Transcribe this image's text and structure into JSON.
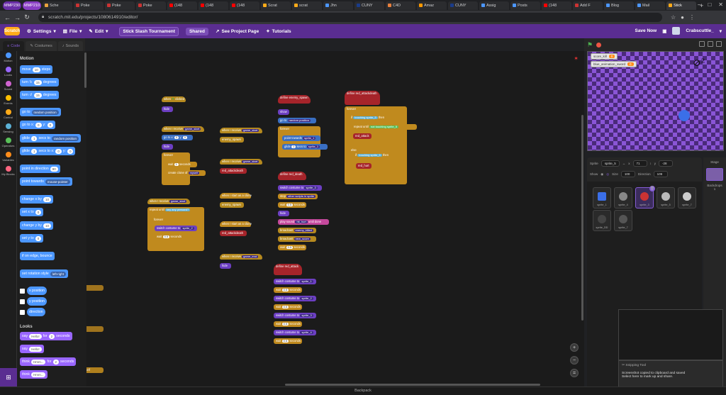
{
  "browser": {
    "tabs": [
      {
        "label": "MMP230",
        "pill": true
      },
      {
        "label": "MMP210",
        "pill": true
      },
      {
        "label": "Sche",
        "color": "#e8a33d"
      },
      {
        "label": "Poke",
        "color": "#cc3333"
      },
      {
        "label": "Poke",
        "color": "#cc3333"
      },
      {
        "label": "Poke",
        "color": "#cc3333"
      },
      {
        "label": "(148",
        "color": "#ff0000"
      },
      {
        "label": "(148",
        "color": "#ff0000"
      },
      {
        "label": "(148",
        "color": "#ff0000"
      },
      {
        "label": "Scrat",
        "color": "#ffab19"
      },
      {
        "label": "scrat",
        "color": "#ffab19"
      },
      {
        "label": "Jhn",
        "color": "#4c97ff"
      },
      {
        "label": "CUNY",
        "color": "#1a3c8a"
      },
      {
        "label": "C4D",
        "color": "#e8803d"
      },
      {
        "label": "Amaz",
        "color": "#ff9900"
      },
      {
        "label": "CUNY",
        "color": "#1a3c8a"
      },
      {
        "label": "Assig",
        "color": "#4c97ff"
      },
      {
        "label": "Posts",
        "color": "#4c97ff"
      },
      {
        "label": "(148",
        "color": "#ff0000"
      },
      {
        "label": "Add F",
        "color": "#cc3333"
      },
      {
        "label": "Blog",
        "color": "#4c97ff"
      },
      {
        "label": "Mail",
        "color": "#4c97ff"
      },
      {
        "label": "Stick",
        "color": "#ffab19",
        "active": true
      }
    ],
    "url": "scratch.mit.edu/projects/1080614910/editor/"
  },
  "menu": {
    "logo": "Scratch",
    "settings": "Settings",
    "file": "File",
    "edit": "Edit",
    "project_title": "Stick Slash Tournament",
    "shared": "Shared",
    "see_project_page": "See Project Page",
    "tutorials": "Tutorials",
    "save_now": "Save Now",
    "username": "Crabscuttle_"
  },
  "editor_tabs": {
    "code": "Code",
    "costumes": "Costumes",
    "sounds": "Sounds"
  },
  "categories": [
    {
      "label": "Motion",
      "color": "#4c97ff"
    },
    {
      "label": "Looks",
      "color": "#9966ff"
    },
    {
      "label": "Sound",
      "color": "#cf63cf"
    },
    {
      "label": "Events",
      "color": "#ffbf00"
    },
    {
      "label": "Control",
      "color": "#ffab19"
    },
    {
      "label": "Sensing",
      "color": "#5cb1d6"
    },
    {
      "label": "Operators",
      "color": "#59c059"
    },
    {
      "label": "Variables",
      "color": "#ff8c1a"
    },
    {
      "label": "My Blocks",
      "color": "#ff6680"
    }
  ],
  "palette": {
    "motion_header": "Motion",
    "looks_header": "Looks",
    "move": "move",
    "move_val": "10",
    "steps": "steps",
    "turn": "turn",
    "turn1_val": "15",
    "degrees": "degrees",
    "turn2_val": "15",
    "goto": "go to",
    "goto_val": "random position",
    "gotoxy": "go to x:",
    "x_val": "0",
    "y_label": "y:",
    "y_val": "0",
    "glide1": "glide",
    "glide_secs": "1",
    "secs_to": "secs to",
    "glide1_val": "random position",
    "glide2_x": "secs to x:",
    "point_dir": "point in direction",
    "dir_val": "90",
    "point_towards": "point towards",
    "towards_val": "mouse-pointer",
    "change_x": "change x by",
    "change_val": "10",
    "set_x": "set x to",
    "set_x_val": "0",
    "change_y": "change y by",
    "set_y": "set y to",
    "bounce": "if on edge, bounce",
    "rotation": "set rotation style",
    "rotation_val": "left-right",
    "xpos": "x position",
    "ypos": "y position",
    "direction": "direction",
    "say_for": "say",
    "hello": "Hello!",
    "for": "for",
    "seconds": "seconds",
    "say_secs": "2",
    "say": "say",
    "think_for": "think",
    "hmm": "Hmm...",
    "think_secs": "2",
    "think": "think"
  },
  "code_blocks": {
    "when_flag": "when",
    "clicked": "clicked",
    "hide": "hide",
    "when_receive": "when I receive",
    "game_start": "game_start",
    "game_end": "game_end",
    "goto_xy": "go to x:",
    "x0": "0",
    "y_lbl": "y:",
    "y0": "0",
    "forever": "forever",
    "wait": "wait",
    "wait1": "1",
    "seconds": "seconds",
    "create_clone": "create clone of",
    "myself": "myself",
    "enemy_spawn": "enemy_spawn",
    "red_attackdeath": "red_attackdeath",
    "repeat_until": "repeat until",
    "key": "key",
    "any": "any",
    "pressed": "pressed?",
    "switch_costume": "switch costume to",
    "sprite_2": "sprite_2",
    "wait_half": "0.5",
    "start_clone": "when I start as a clone",
    "show": "show",
    "random_position": "random position",
    "point_dir": "point in direction",
    "dir_val": "90",
    "glide": "glide",
    "secs_to": "secs to",
    "define_red_death": "define",
    "red_death": "red_death",
    "sprite_3": "sprite_3",
    "stop": "stop",
    "other_scripts": "other scripts in sprite",
    "play_sound": "play sound",
    "hit_hurt": "hit_hurt",
    "until_done": "until done",
    "broadcast": "broadcast",
    "enemy_killed": "enemy_killed",
    "new_score": "new_score",
    "define_red_attack": "define",
    "red_attack": "red_attack",
    "sprite_1": "sprite_1",
    "sprite_4": "sprite_4",
    "define_attackdeath": "define",
    "if": "if",
    "touching": "touching",
    "sprite_5": "sprite_5",
    "then": "then",
    "else": "else",
    "not": "not",
    "red_hurt": "red_hurt",
    "start": "start"
  },
  "stage": {
    "monitors": [
      {
        "label": "score_kill",
        "value": "0"
      },
      {
        "label": "blue_animation_sword",
        "value": "0"
      }
    ]
  },
  "sprite_info": {
    "sprite_label": "Sprite",
    "sprite_name": "sprite_5",
    "x_label": "x",
    "x_val": "71",
    "y_label": "y",
    "y_val": "-28",
    "show_label": "Show",
    "size_label": "Size",
    "size_val": "100",
    "direction_label": "Direction",
    "direction_val": "109"
  },
  "sprites": [
    {
      "name": "sprite_1",
      "color": "#3b6fe8"
    },
    {
      "name": "sprite_4",
      "color": "#888"
    },
    {
      "name": "sprite_3",
      "color": "#c33",
      "selected": true
    },
    {
      "name": "sprite_5",
      "color": "#bbb"
    },
    {
      "name": "sprite_7",
      "color": "#ccc"
    },
    {
      "name": "sprite_DD",
      "color": "#444"
    },
    {
      "name": "sprite_7",
      "color": "#555"
    }
  ],
  "stage_pane": {
    "title": "Stage",
    "backdrops_label": "Backdrops",
    "backdrops_count": "1"
  },
  "snipping": {
    "title": "Snipping Tool",
    "line1": "Screenshot copied to clipboard and saved",
    "line2": "Select here to mark up and share."
  },
  "backpack": "Backpack"
}
